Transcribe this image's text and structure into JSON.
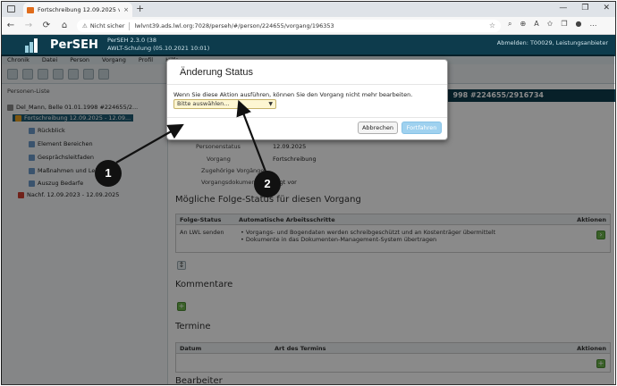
{
  "browser": {
    "tab_title": "Fortschreibung 12.09.2025 von (",
    "tab_close": "×",
    "new_tab": "+",
    "window_controls": [
      "—",
      "❐",
      "✕"
    ],
    "security_label": "Nicht sicher",
    "url": "lwlvnt39.ads.lwl.org:7028/perseh/#/person/224655/vorgang/196353",
    "nav": {
      "back": "←",
      "forward": "→",
      "reload": "⟳",
      "home": "⌂"
    }
  },
  "app": {
    "name": "PerSEH",
    "version_line1": "PerSEH 2.3.0 (38",
    "version_line2": "AWLT-Schulung (05.10.2021 10:01)",
    "user_info": "Abmelden: T00029, Leistungsanbieter"
  },
  "menubar": [
    "Chronik",
    "Datei",
    "Person",
    "Vorgang",
    "Profil",
    "Hilfe"
  ],
  "sidebar": {
    "title": "Personen-Liste",
    "tree": [
      {
        "label": "Del_Mann, Belle 01.01.1998 #224655/2...",
        "selected": false
      },
      {
        "label": "Fortschreibung 12.09.2025 - 12.09...",
        "selected": true
      },
      {
        "label": "Rückblick",
        "selected": false
      },
      {
        "label": "Element Bereichen",
        "selected": false
      },
      {
        "label": "Gesprächsleitfaden",
        "selected": false
      },
      {
        "label": "Maßnahmen und Leistungen",
        "selected": false
      },
      {
        "label": "Auszug Bedarfe",
        "selected": false
      },
      {
        "label": "Nachf. 12.09.2023 - 12.09.2025",
        "selected": false
      }
    ]
  },
  "main": {
    "process_title": "998 #224655/2916734",
    "fields": [
      {
        "label": "Personenstatus",
        "value": "12.09.2025"
      },
      {
        "label": "Vorgang",
        "value": "Fortschreibung"
      },
      {
        "label": "Zugehörige Vorgänge",
        "value": ""
      },
      {
        "label": "Vorgangsdokument",
        "value": "liegt vor"
      }
    ],
    "followup_heading": "Mögliche Folge-Status für diesen Vorgang",
    "followup_table": {
      "headers": [
        "Folge-Status",
        "Automatische Arbeitsschritte",
        "Aktionen"
      ],
      "row_status": "An LWL senden",
      "row_steps": [
        "Vorgangs- und Bogendaten werden schreibgeschützt und an Kostenträger übermittelt",
        "Dokumente in das Dokumenten-Management-System übertragen"
      ]
    },
    "comments_heading": "Kommentare",
    "appointments_heading": "Termine",
    "appointments_table": {
      "headers": [
        "Datum",
        "Art des Termins",
        "Aktionen"
      ]
    },
    "editors_heading": "Bearbeiter"
  },
  "dialog": {
    "title": "Änderung Status",
    "message": "Wenn Sie diese Aktion ausführen, können Sie den Vorgang nicht mehr bearbeiten.",
    "select_placeholder": "Bitte auswählen...",
    "cancel_label": "Abbrechen",
    "confirm_label": "Fortfahren"
  },
  "annotations": [
    "1",
    "2"
  ],
  "colors": {
    "header": "#0d3b4c",
    "confirm": "#9fd1ef",
    "select_bg": "#fdf6d2"
  }
}
